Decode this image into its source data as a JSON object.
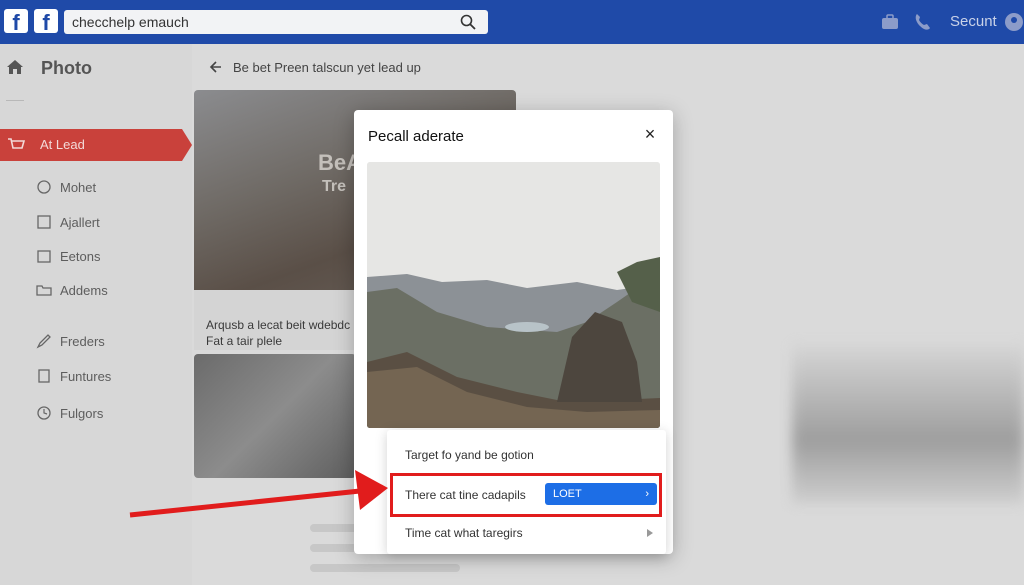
{
  "topbar": {
    "search_placeholder": "checchelp emauch",
    "right_label": "Secunt",
    "icons": [
      "facebook-logo",
      "search-icon",
      "briefcase-icon",
      "phone-icon",
      "user-icon"
    ]
  },
  "sidebar": {
    "title": "Photo",
    "active_label": "At Lead",
    "items": [
      {
        "label": "Mohet",
        "icon": "comment-icon"
      },
      {
        "label": "Ajallert",
        "icon": "alert-icon"
      },
      {
        "label": "Eetons",
        "icon": "calendar-icon"
      },
      {
        "label": "Addems",
        "icon": "folder-icon"
      },
      {
        "label": "Freders",
        "icon": "pen-icon"
      },
      {
        "label": "Funtures",
        "icon": "box-icon"
      },
      {
        "label": "Fulgors",
        "icon": "clock-icon"
      }
    ]
  },
  "main": {
    "breadcrumb": "Be bet Preen talscun yet lead up",
    "feed_caption_1": "Arqusb a lecat beit wdebdc",
    "feed_caption_2": "Fat a tair plele",
    "card_overlay_text": "BeA",
    "card_overlay_text_2": "Tre"
  },
  "modal": {
    "title": "Pecall aderate",
    "close_label": "×"
  },
  "menu": {
    "item_1": "Target fo yand be gotion",
    "item_2": "There cat tine cadapils",
    "item_2_button": "LOET",
    "item_3": "Time cat what taregirs"
  },
  "colors": {
    "topbar": "#1f4aa8",
    "active": "#c9413b",
    "highlight": "#e11c1c",
    "cta": "#1d6ee6"
  }
}
